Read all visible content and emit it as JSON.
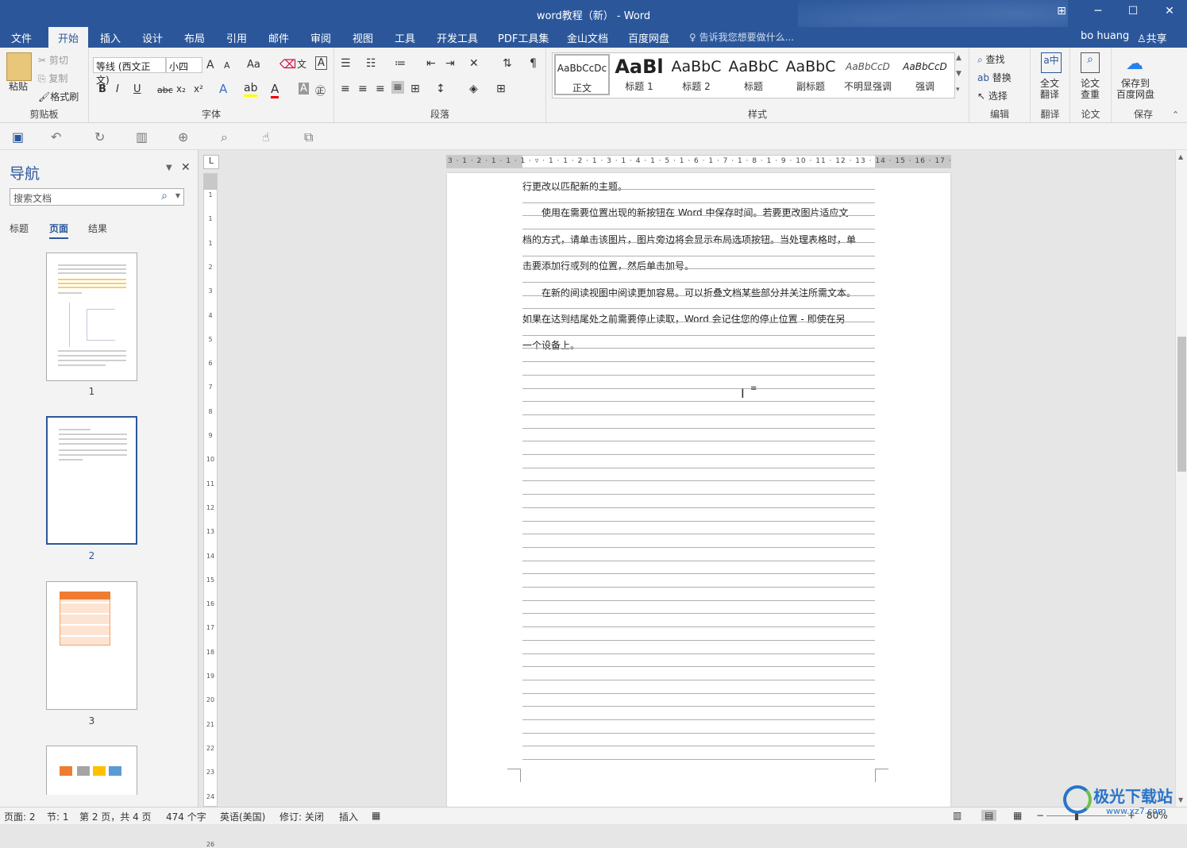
{
  "window": {
    "title": "word教程（新） - Word",
    "restore_icon": "⊞",
    "minimize": "─",
    "maximize": "☐",
    "close": "✕"
  },
  "tabs": [
    "文件",
    "开始",
    "插入",
    "设计",
    "布局",
    "引用",
    "邮件",
    "审阅",
    "视图",
    "工具",
    "开发工具",
    "PDF工具集",
    "金山文档",
    "百度网盘"
  ],
  "active_tab": "开始",
  "tellme": "告诉我您想要做什么...",
  "user": "bo huang",
  "share": "共享",
  "clipboard": {
    "paste": "粘贴",
    "cut": "剪切",
    "copy": "复制",
    "format_painter": "格式刷",
    "label": "剪贴板"
  },
  "font": {
    "name": "等线 (西文正文)",
    "size": "小四",
    "label": "字体",
    "change_case": "Aa"
  },
  "paragraph": {
    "label": "段落"
  },
  "styles": {
    "label": "样式",
    "items": [
      {
        "preview": "AaBbCcDc",
        "name": "正文"
      },
      {
        "preview": "AaBl",
        "name": "标题 1"
      },
      {
        "preview": "AaBbC",
        "name": "标题 2"
      },
      {
        "preview": "AaBbC",
        "name": "标题"
      },
      {
        "preview": "AaBbC",
        "name": "副标题"
      },
      {
        "preview": "AaBbCcD",
        "name": "不明显强调"
      },
      {
        "preview": "AaBbCcD",
        "name": "强调"
      }
    ]
  },
  "editing": {
    "find": "查找",
    "replace": "替换",
    "select": "选择",
    "label": "编辑"
  },
  "translate": {
    "button": "全文\n翻译",
    "label": "翻译",
    "btn1": "全文",
    "btn2": "翻译"
  },
  "paper": {
    "btn1": "论文",
    "btn2": "查重",
    "label": "论文"
  },
  "save_group": {
    "btn1": "保存到",
    "btn2": "百度网盘",
    "label": "保存"
  },
  "nav": {
    "title": "导航",
    "search_placeholder": "搜索文档",
    "tabs": [
      "标题",
      "页面",
      "结果"
    ],
    "active_tab": "页面",
    "pages": [
      "1",
      "2",
      "3"
    ]
  },
  "ruler": {
    "corner": "L",
    "numbers": "3 · 1 · 2 · 1 · 1 · 1 · ▿ · 1 · 1 · 2 · 1 · 3 · 1 · 4 · 1 · 5 · 1 · 6 · 1 · 7 · 1 · 8 · 1 · 9 · 10 · 11 · 12 · 13 · 14 · 15 · 16 · 17 · 1",
    "vnums": [
      "1",
      "1",
      "1",
      "2",
      "3",
      "4",
      "5",
      "6",
      "7",
      "8",
      "9",
      "10",
      "11",
      "12",
      "13",
      "14",
      "15",
      "16",
      "17",
      "18",
      "19",
      "20",
      "21",
      "22",
      "23",
      "24",
      "25",
      "26"
    ]
  },
  "document": {
    "lines": [
      "行更改以匹配新的主题。",
      "　　使用在需要位置出现的新按钮在 Word 中保存时间。若要更改图片适应文",
      "档的方式，请单击该图片，图片旁边将会显示布局选项按钮。当处理表格时，单",
      "击要添加行或列的位置，然后单击加号。",
      "　　在新的阅读视图中阅读更加容易。可以折叠文档某些部分并关注所需文本。",
      "如果在达到结尾处之前需要停止读取，Word 会记住您的停止位置 - 即使在另",
      "一个设备上。"
    ]
  },
  "status": {
    "page": "页面: 2",
    "section": "节: 1",
    "pages": "第 2 页，共 4 页",
    "words": "474 个字",
    "lang": "英语(美国)",
    "track": "修订: 关闭",
    "mode": "插入",
    "zoom": "80%"
  },
  "watermark": {
    "name": "极光下载站",
    "url": "www.xz7.com"
  }
}
